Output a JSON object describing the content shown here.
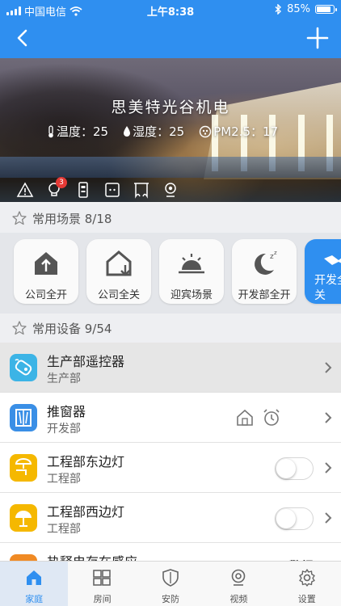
{
  "status_bar": {
    "carrier": "中国电信",
    "time": "上午8:38",
    "battery": "85%",
    "battery_level": 0.85
  },
  "nav": {
    "back_icon": "chevron-left-icon",
    "add_icon": "plus-icon"
  },
  "banner": {
    "title": "思美特光谷机电",
    "temperature": "温度：25",
    "humidity": "湿度：25",
    "pm25": "PM2.5：17",
    "alert_badge": "3",
    "icons": [
      "warning-icon",
      "lightbulb-icon",
      "lock-icon",
      "socket-icon",
      "curtain-icon",
      "camera-icon"
    ]
  },
  "scenes_section": {
    "title": "常用场景 8/18",
    "items": [
      {
        "label": "公司全开",
        "icon": "house-up-icon"
      },
      {
        "label": "公司全关",
        "icon": "house-down-icon"
      },
      {
        "label": "迎宾场景",
        "icon": "sunrise-icon"
      },
      {
        "label": "开发部全开",
        "icon": "moon-sleep-icon"
      },
      {
        "label": "开发全关",
        "icon": "handshake-icon"
      }
    ]
  },
  "devices_section": {
    "title": "常用设备 9/54",
    "items": [
      {
        "name": "生产部遥控器",
        "room": "生产部",
        "icon": "remote-icon",
        "color": "#3cb4e6"
      },
      {
        "name": "推窗器",
        "room": "开发部",
        "icon": "window-icon",
        "color": "#3a8fe6"
      },
      {
        "name": "工程部东边灯",
        "room": "工程部",
        "icon": "wall-lamp-icon",
        "color": "#f5b800",
        "on": false
      },
      {
        "name": "工程部西边灯",
        "room": "工程部",
        "icon": "table-lamp-icon",
        "color": "#f5b800",
        "on": false
      },
      {
        "name": "热释电存在感应",
        "room": "",
        "icon": "sensor-icon",
        "color": "#f08a24",
        "status": "警报"
      }
    ]
  },
  "tabbar": {
    "items": [
      {
        "label": "家庭",
        "icon": "home-icon",
        "active": true
      },
      {
        "label": "房间",
        "icon": "rooms-icon",
        "active": false
      },
      {
        "label": "安防",
        "icon": "shield-icon",
        "active": false
      },
      {
        "label": "视频",
        "icon": "camera-icon",
        "active": false
      },
      {
        "label": "设置",
        "icon": "gear-icon",
        "active": false
      }
    ]
  },
  "colors": {
    "accent": "#2f8ff0",
    "lamp_yellow": "#f5b800"
  }
}
